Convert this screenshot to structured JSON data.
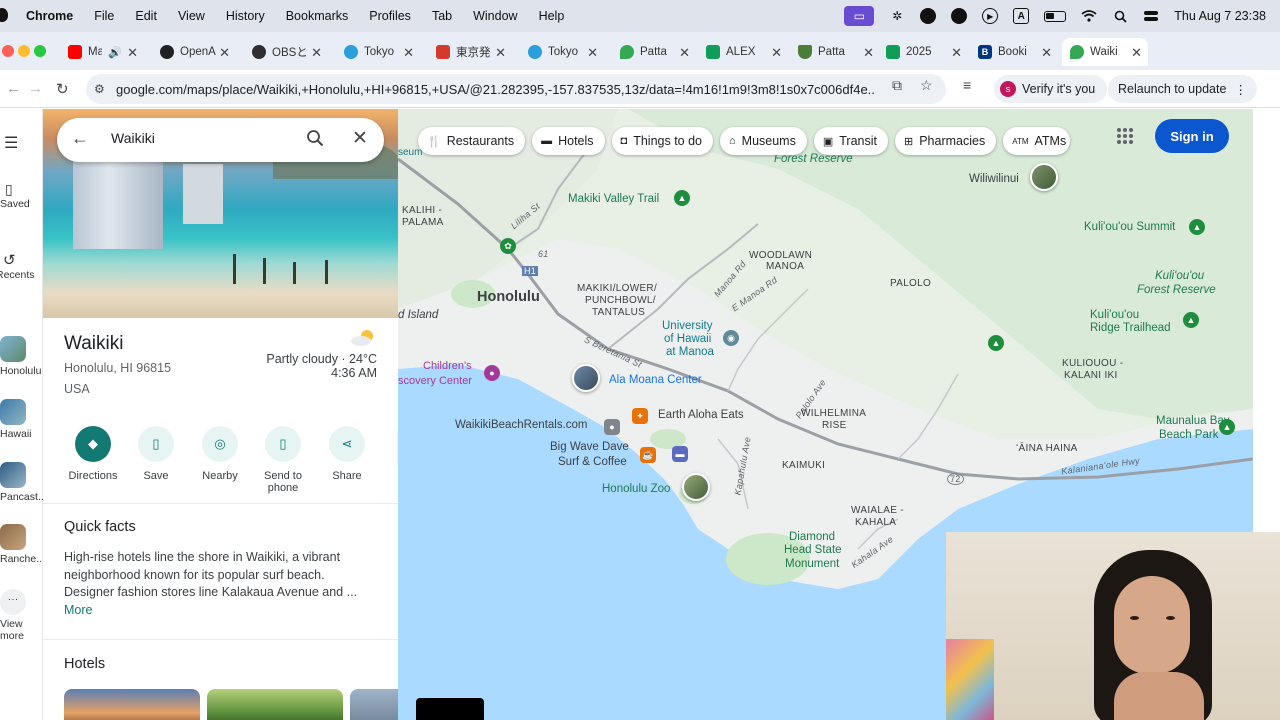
{
  "menubar": {
    "app": "Chrome",
    "menus": [
      "File",
      "Edit",
      "View",
      "History",
      "Bookmarks",
      "Profiles",
      "Tab",
      "Window",
      "Help"
    ],
    "icons": [
      "screen-mirroring-icon",
      "bluetooth-icon",
      "focus-icon",
      "creative-cloud-icon",
      "play-icon",
      "input-source-icon",
      "battery-icon",
      "wifi-icon",
      "spotlight-icon",
      "control-center-icon"
    ],
    "clock": "Thu Aug 7  23:38"
  },
  "tabs": [
    {
      "title": "Ma",
      "icon": "youtube-icon",
      "color": "#ff0000"
    },
    {
      "title": "OpenA",
      "icon": "openai-icon",
      "color": "#202124"
    },
    {
      "title": "OBSと",
      "icon": "obs-icon",
      "color": "#302e31"
    },
    {
      "title": "Tokyo",
      "icon": "tokyo-icon",
      "color": "#2b9fd9"
    },
    {
      "title": "東京発",
      "icon": "page-icon",
      "color": "#d33a2c"
    },
    {
      "title": "Tokyo",
      "icon": "tokyo-icon",
      "color": "#2b9fd9"
    },
    {
      "title": "Patta",
      "icon": "maps-pin-icon",
      "color": "#34a853"
    },
    {
      "title": "ALEX",
      "icon": "sheet-icon",
      "color": "#0f9d58"
    },
    {
      "title": "Patta",
      "icon": "palm-icon",
      "color": "#4a7c3a"
    },
    {
      "title": "2025",
      "icon": "sheet-icon",
      "color": "#0f9d58"
    },
    {
      "title": "Booki",
      "icon": "booking-icon",
      "color": "#003580"
    },
    {
      "title": "Waiki",
      "icon": "maps-pin-icon",
      "color": "#34a853",
      "active": true
    }
  ],
  "address": {
    "url": "google.com/maps/place/Waikiki,+Honolulu,+HI+96815,+USA/@21.282395,-157.837535,13z/data=!4m16!1m9!3m8!1s0x7c006df4e...",
    "verify_label": "Verify it's you",
    "relaunch_label": "Relaunch to update"
  },
  "rail": {
    "saved": "Saved",
    "recents": "Recents",
    "recent_places": [
      "Honolulu",
      "Hawaii",
      "Pancast...",
      "Ranche..."
    ],
    "view_more_1": "View",
    "view_more_2": "more"
  },
  "search": {
    "value": "Waikiki"
  },
  "place": {
    "name": "Waikiki",
    "addr_line1": "Honolulu, HI 96815",
    "addr_line2": "USA",
    "weather_line1": "Partly cloudy · 24°C",
    "weather_line2": "4:36 AM"
  },
  "actions": [
    {
      "label": "Directions",
      "icon": "directions-icon"
    },
    {
      "label": "Save",
      "icon": "bookmark-icon"
    },
    {
      "label": "Nearby",
      "icon": "nearby-icon"
    },
    {
      "label": "Send to phone",
      "label_1": "Send to",
      "label_2": "phone",
      "icon": "send-to-phone-icon"
    },
    {
      "label": "Share",
      "icon": "share-icon"
    }
  ],
  "quick_facts": {
    "title": "Quick facts",
    "line1": "High-rise hotels line the shore in Waikiki, a vibrant",
    "line2": "neighborhood known for its popular surf beach.",
    "line3": "Designer fashion stores line Kalakaua Avenue and ...",
    "more": "More"
  },
  "hotels": {
    "title": "Hotels"
  },
  "chips": [
    {
      "label": "Restaurants",
      "icon": "restaurant-icon"
    },
    {
      "label": "Hotels",
      "icon": "hotel-icon"
    },
    {
      "label": "Things to do",
      "icon": "camera-icon"
    },
    {
      "label": "Museums",
      "icon": "museum-icon"
    },
    {
      "label": "Transit",
      "icon": "transit-icon"
    },
    {
      "label": "Pharmacies",
      "icon": "pharmacy-icon"
    },
    {
      "label": "ATMs",
      "icon": "atm-icon",
      "icon_text": "ATM"
    }
  ],
  "signin": "Sign in",
  "map_labels": {
    "museum": "seum",
    "forest_reserve": "Forest Reserve",
    "wiliwilinui": "Wiliwilinui",
    "kalihi": "KALIHI -",
    "palama": "PALAMA",
    "lilihast": "Liliha St",
    "makiki_trail": "Makiki Valley Trail",
    "woodlawn": "WOODLAWN",
    "manoa": "MANOA",
    "kulioou_summit": "Kuli'ou'ou Summit",
    "kulioou_forest1": "Kuli'ou'ou",
    "kulioou_forest2": "Forest Reserve",
    "honolulu": "Honolulu",
    "makiki_lower": "MAKIKI/LOWER/",
    "punchbowl": "PUNCHBOWL/",
    "tantalus": "TANTALUS",
    "manoa_rd": "Manoa Rd",
    "e_manoa_rd": "E Manoa Rd",
    "palolo": "PALOLO",
    "ridge_trailhead1": "Kuli'ou'ou",
    "ridge_trailhead2": "Ridge Trailhead",
    "island": "d Island",
    "uh1": "University",
    "uh2": "of Hawaii",
    "uh3": "at Manoa",
    "childrens1": "Children's",
    "childrens2": "scovery Center",
    "s_beretania": "S Beretania St",
    "ala_moana": "Ala Moana Center",
    "kuliouou_kalani1": "KULIOUOU -",
    "kuliouou_kalani2": "KALANI IKI",
    "palolo_ave": "Palolo Ave",
    "earth_aloha": "Earth Aloha Eats",
    "wilhelmina1": "WILHELMINA",
    "wilhelmina2": "RISE",
    "maunalua1": "Maunalua Bay",
    "maunalua2": "Beach Park",
    "waikiki_rentals": "WaikikiBeachRentals.com",
    "big_wave1": "Big Wave Dave",
    "big_wave2": "Surf & Coffee",
    "kapahulu_ave": "Kapahulu Ave",
    "kaimuki": "KAIMUKI",
    "aina_haina": "ʻĀINA HAINA",
    "kalanianaole": "Kalanianaʻole Hwy",
    "honolulu_zoo": "Honolulu Zoo",
    "route_72": "72",
    "route_61": "61",
    "route_h1": "H1",
    "waialae1": "WAIALAE -",
    "waialae2": "KAHALA",
    "diamond1": "Diamond",
    "diamond2": "Head State",
    "diamond3": "Monument",
    "kahala_ave": "Kahala Ave"
  }
}
